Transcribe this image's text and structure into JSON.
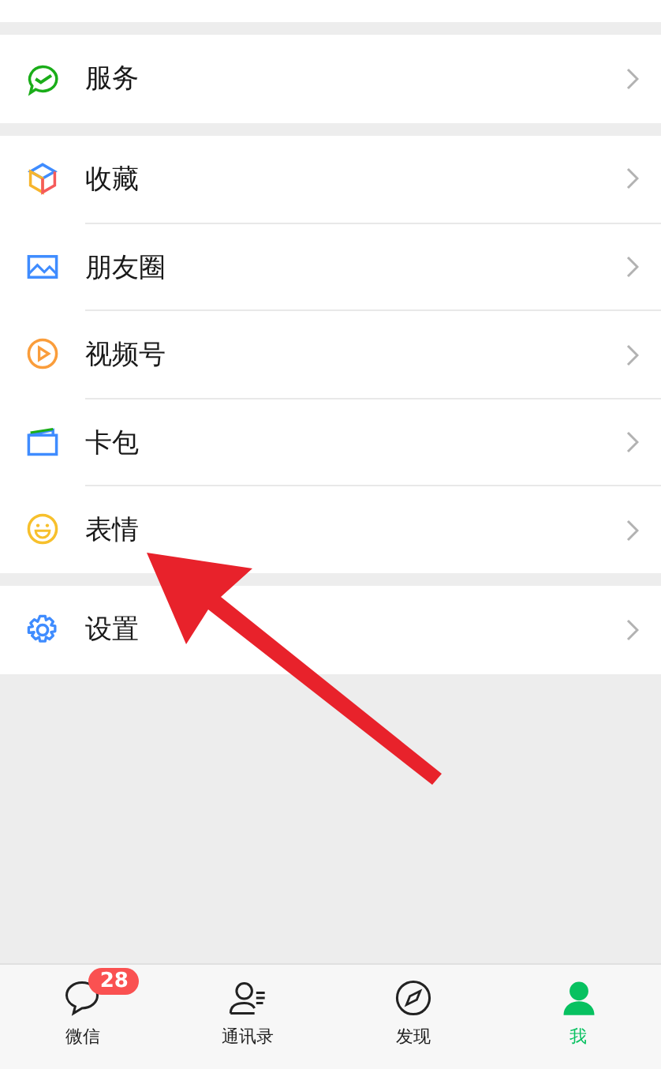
{
  "groups": [
    [
      {
        "label": "服务"
      }
    ],
    [
      {
        "label": "收藏"
      },
      {
        "label": "朋友圈"
      },
      {
        "label": "视频号"
      },
      {
        "label": "卡包"
      },
      {
        "label": "表情"
      }
    ],
    [
      {
        "label": "设置"
      }
    ]
  ],
  "tabs": [
    {
      "label": "微信",
      "selected": false,
      "badge": "28"
    },
    {
      "label": "通讯录",
      "selected": false
    },
    {
      "label": "发现",
      "selected": false
    },
    {
      "label": "我",
      "selected": true
    }
  ]
}
